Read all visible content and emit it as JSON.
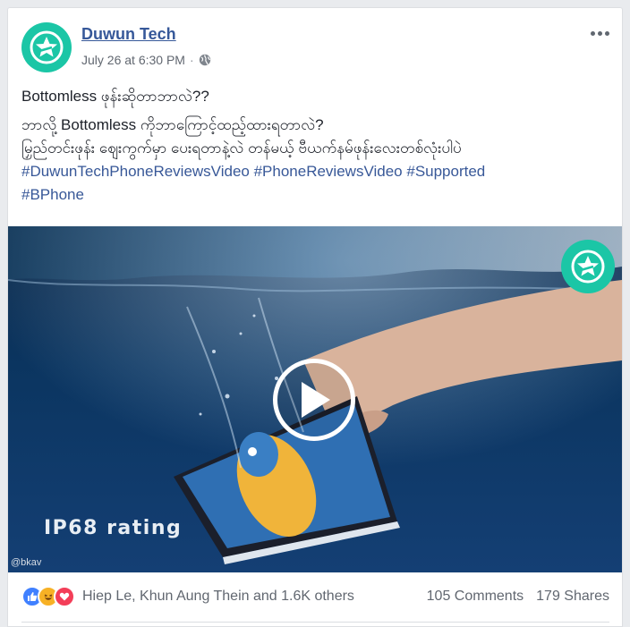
{
  "post": {
    "page_name": "Duwun Tech",
    "timestamp": "July 26 at 6:30 PM",
    "separator": "·",
    "privacy_icon": "globe-icon",
    "more_icon": "more-dots-icon"
  },
  "text": {
    "line1": "Bottomless ဖုန်းဆိုတာဘာလဲ??",
    "line2": "ဘာလို့ Bottomless ကိုဘာကြောင့်ထည့်ထားရတာလဲ?",
    "line3": "မြှည်တင်းဖုန်း ဈေးကွက်မှာ ပေးရတာနဲ့လဲ တန်မယ့် ဗီယက်နမ်ဖုန်းလေးတစ်လုံးပါပဲ",
    "hashtags_line1": [
      "#DuwunTechPhoneReviewsVideo",
      "#PhoneReviewsVideo",
      "#Supported"
    ],
    "hashtags_line2": [
      "#BPhone"
    ]
  },
  "video": {
    "overlay_text": "IP68 rating",
    "watermark": "@bkav",
    "play_icon": "play-icon",
    "brand_badge_icon": "star-logo-icon"
  },
  "footer": {
    "reaction_icons": [
      "like-icon",
      "haha-icon",
      "love-icon"
    ],
    "reacted_by": "Hiep Le, Khun Aung Thein and 1.6K others",
    "comments": "105 Comments",
    "shares": "179 Shares"
  },
  "colors": {
    "brand_teal": "#1bc6a6",
    "link_blue": "#385898",
    "name_blue": "#365899",
    "meta_gray": "#616770"
  }
}
